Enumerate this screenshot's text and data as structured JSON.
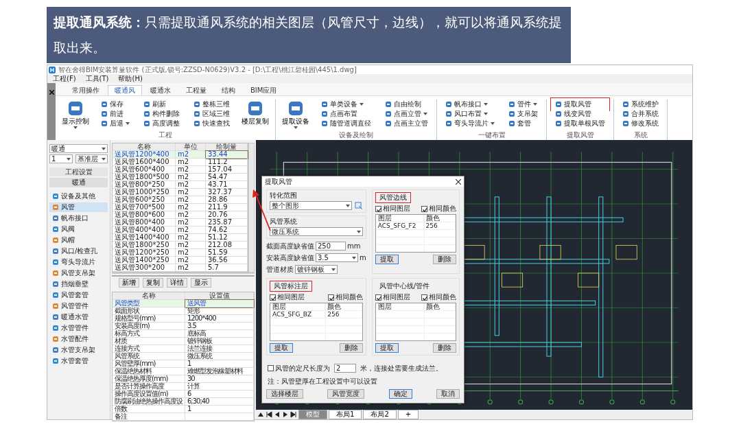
{
  "banner": {
    "text": "**提取通风系统：**只需提取通风系统的相关图层（风管尺寸，边线），就可以将通风系统提取出来。"
  },
  "app": {
    "title": "智在舍得BIM安装算量软件 (正式版,锁号:ZZSD-N0629)V3.2 - [D:\\工程\\桃江碧桂园\\445\\1.dwg]",
    "menu": [
      "工程(F)",
      "工具(T)",
      "帮助(H)"
    ],
    "tabs": [
      {
        "label": "常用操作",
        "selected": false
      },
      {
        "label": "暖通风",
        "selected": true
      },
      {
        "label": "暖通水",
        "selected": false
      },
      {
        "label": "工程量",
        "selected": false
      },
      {
        "label": "结构",
        "selected": false
      },
      {
        "label": "BIM应用",
        "selected": false
      }
    ],
    "ribbon": [
      {
        "label": "工程",
        "items": [
          {
            "label": "显示控制",
            "kind": "large",
            "dropdown": true,
            "highlighted": false
          },
          {
            "label": "保存",
            "kind": "small",
            "dropdown": false,
            "highlighted": false
          },
          {
            "label": "前进",
            "kind": "small",
            "dropdown": false,
            "highlighted": false
          },
          {
            "label": "后退",
            "kind": "small",
            "dropdown": true,
            "highlighted": false
          },
          {
            "label": "刷新",
            "kind": "small",
            "dropdown": false,
            "highlighted": false
          },
          {
            "label": "构件删除",
            "kind": "small",
            "dropdown": false,
            "highlighted": false
          },
          {
            "label": "高度调整",
            "kind": "small",
            "dropdown": false,
            "highlighted": false
          },
          {
            "label": "整栋三维",
            "kind": "small",
            "dropdown": false,
            "highlighted": false
          },
          {
            "label": "区域三维",
            "kind": "small",
            "dropdown": false,
            "highlighted": false
          },
          {
            "label": "快速查找",
            "kind": "small",
            "dropdown": false,
            "highlighted": false
          },
          {
            "label": "楼层复制",
            "kind": "large",
            "dropdown": false,
            "highlighted": false
          }
        ]
      },
      {
        "label": "设备及绘制",
        "items": [
          {
            "label": "提取设备",
            "kind": "large",
            "dropdown": true,
            "highlighted": false
          },
          {
            "label": "单类设备",
            "kind": "small",
            "dropdown": true,
            "highlighted": false
          },
          {
            "label": "点画布置",
            "kind": "small",
            "dropdown": false,
            "highlighted": false
          },
          {
            "label": "随管道调直径",
            "kind": "small",
            "dropdown": false,
            "highlighted": false
          },
          {
            "label": "自由绘制",
            "kind": "small",
            "dropdown": false,
            "highlighted": false
          },
          {
            "label": "点画立管",
            "kind": "small",
            "dropdown": true,
            "highlighted": false
          },
          {
            "label": "点画主立管",
            "kind": "small",
            "dropdown": false,
            "highlighted": false
          }
        ]
      },
      {
        "label": "一键布置",
        "items": [
          {
            "label": "帆布接口",
            "kind": "small",
            "dropdown": true,
            "highlighted": false
          },
          {
            "label": "风口布置",
            "kind": "small",
            "dropdown": true,
            "highlighted": false
          },
          {
            "label": "弯头导流片",
            "kind": "small",
            "dropdown": true,
            "highlighted": false
          },
          {
            "label": "管件",
            "kind": "small",
            "dropdown": true,
            "highlighted": false
          },
          {
            "label": "支吊架",
            "kind": "small",
            "dropdown": false,
            "highlighted": false
          },
          {
            "label": "套管",
            "kind": "small",
            "dropdown": false,
            "highlighted": false
          }
        ]
      },
      {
        "label": "提取风管",
        "items": [
          {
            "label": "提取风管",
            "kind": "small",
            "dropdown": false,
            "highlighted": true
          },
          {
            "label": "线变风管",
            "kind": "small",
            "dropdown": false,
            "highlighted": false
          },
          {
            "label": "提取单根风管",
            "kind": "small",
            "dropdown": false,
            "highlighted": false
          }
        ]
      },
      {
        "label": "系统",
        "items": [
          {
            "label": "系统维护",
            "kind": "small",
            "dropdown": false,
            "highlighted": false
          },
          {
            "label": "合并系统",
            "kind": "small",
            "dropdown": false,
            "highlighted": false
          },
          {
            "label": "修改系统",
            "kind": "small",
            "dropdown": false,
            "highlighted": false
          }
        ]
      }
    ],
    "left_panel": {
      "discipline": "暖通",
      "floor": "1",
      "floor_type": "基准层",
      "settings_button": "工程设置",
      "section": "暖通",
      "items": [
        {
          "label": "设备及其他",
          "selected": false
        },
        {
          "label": "风管",
          "selected": true
        },
        {
          "label": "帆布接口",
          "selected": false
        },
        {
          "label": "风阀",
          "selected": false
        },
        {
          "label": "风帽",
          "selected": false
        },
        {
          "label": "风口/检查孔",
          "selected": false
        },
        {
          "label": "弯头导流片",
          "selected": false
        },
        {
          "label": "风管支吊架",
          "selected": false
        },
        {
          "label": "挡烟垂壁",
          "selected": false
        },
        {
          "label": "风管套管",
          "selected": false
        },
        {
          "label": "风管管件",
          "selected": false
        },
        {
          "label": "暖通水管",
          "selected": false
        },
        {
          "label": "水管管件",
          "selected": false
        },
        {
          "label": "水管配件",
          "selected": false
        },
        {
          "label": "水管支吊架",
          "selected": false
        },
        {
          "label": "水管套管",
          "selected": false
        }
      ]
    },
    "component_table": {
      "columns": [
        "名称",
        "单位",
        "绘制量"
      ],
      "rows": [
        {
          "cells": [
            "送风管1200*400",
            "m2",
            "33.44"
          ],
          "selected": true
        },
        {
          "cells": [
            "送风管1600*400",
            "m2",
            "111.2"
          ],
          "selected": false
        },
        {
          "cells": [
            "送风管600*400",
            "m2",
            "157.04"
          ],
          "selected": false
        },
        {
          "cells": [
            "送风管1800*500",
            "m2",
            "54.47"
          ],
          "selected": false
        },
        {
          "cells": [
            "送风管800*250",
            "m2",
            "43.71"
          ],
          "selected": false
        },
        {
          "cells": [
            "送风管1000*250",
            "m2",
            "327.37"
          ],
          "selected": false
        },
        {
          "cells": [
            "送风管600*250",
            "m2",
            "28.86"
          ],
          "selected": false
        },
        {
          "cells": [
            "送风管700*500",
            "m2",
            "211.9"
          ],
          "selected": false
        },
        {
          "cells": [
            "送风管800*600",
            "m2",
            "20.76"
          ],
          "selected": false
        },
        {
          "cells": [
            "送风管800*400",
            "m2",
            "235.87"
          ],
          "selected": false
        },
        {
          "cells": [
            "送风管400*400",
            "m2",
            "74.62"
          ],
          "selected": false
        },
        {
          "cells": [
            "送风管1400*400",
            "m2",
            "51.12"
          ],
          "selected": false
        },
        {
          "cells": [
            "送风管1800*250",
            "m2",
            "212.08"
          ],
          "selected": false
        },
        {
          "cells": [
            "送风管1200*250",
            "m2",
            "51.59"
          ],
          "selected": false
        },
        {
          "cells": [
            "送风管1400*250",
            "m2",
            "36.56"
          ],
          "selected": false
        },
        {
          "cells": [
            "送风管300*200",
            "m2",
            "5.7"
          ],
          "selected": false
        }
      ]
    },
    "table_buttons": [
      "新增",
      "复制",
      "详情",
      "显示"
    ],
    "property_table": {
      "columns": [
        "名称",
        "设置值"
      ],
      "rows": [
        {
          "cells": [
            "风管类型",
            "送风管"
          ],
          "selected": true
        },
        {
          "cells": [
            "截面形状",
            "矩形"
          ],
          "selected": false
        },
        {
          "cells": [
            "规格型号(mm)",
            "1200*400"
          ],
          "selected": false
        },
        {
          "cells": [
            "安装高度(m)",
            "3.5"
          ],
          "selected": false
        },
        {
          "cells": [
            "标高方式",
            "底标高"
          ],
          "selected": false
        },
        {
          "cells": [
            "材质",
            "镀锌钢板"
          ],
          "selected": false
        },
        {
          "cells": [
            "连接方式",
            "法兰连接"
          ],
          "selected": false
        },
        {
          "cells": [
            "风管系统",
            "微压系统"
          ],
          "selected": false
        },
        {
          "cells": [
            "风管壁厚(mm)",
            "1"
          ],
          "selected": false
        },
        {
          "cells": [
            "保温绝热材料",
            "难燃型发泡橡塑材料"
          ],
          "selected": false
        },
        {
          "cells": [
            "保温绝热厚度(mm)",
            "30"
          ],
          "selected": false
        },
        {
          "cells": [
            "是否计算操作高度",
            "计算"
          ],
          "selected": false
        },
        {
          "cells": [
            "操作高度设置值(m)",
            "6"
          ],
          "selected": false
        },
        {
          "cells": [
            "防腐刷油绝热操作高度设",
            "6;30;40"
          ],
          "selected": false
        },
        {
          "cells": [
            "倍数",
            "1"
          ],
          "selected": false
        },
        {
          "cells": [
            "备注"
          ],
          "selected": false
        }
      ]
    },
    "layout_tabs": [
      {
        "label": "模型",
        "selected": true
      },
      {
        "label": "布局1",
        "selected": false
      },
      {
        "label": "布局2",
        "selected": false
      },
      {
        "label": "+",
        "selected": false
      }
    ],
    "dialog": {
      "title": "提取风管",
      "range": {
        "label": "转化范围",
        "value": "整个图形"
      },
      "system": {
        "label": "风管系统",
        "value": "微压系统"
      },
      "fields": [
        {
          "label": "截面高度缺省值",
          "value": "250",
          "unit": "mm",
          "kind": "text"
        },
        {
          "label": "安装高度缺省值",
          "value": "3.5",
          "unit": "m",
          "kind": "combo"
        },
        {
          "label": "管道材质",
          "value": "镀锌钢板",
          "kind": "combo"
        }
      ],
      "groups": [
        {
          "title": "风管边线",
          "highlighted": true,
          "options": [
            {
              "label": "相同图层",
              "checked": true
            },
            {
              "label": "相同颜色",
              "checked": true
            }
          ],
          "columns": [
            "图层",
            "颜色"
          ],
          "rows": [
            [
              "ACS_SFG_F2",
              "256"
            ]
          ],
          "buttons": [
            {
              "label": "提取",
              "default": true
            },
            {
              "label": "删除",
              "default": false
            }
          ]
        },
        {
          "title": "风管标注层",
          "highlighted": true,
          "options": [
            {
              "label": "相同图层",
              "checked": true
            },
            {
              "label": "相同颜色",
              "checked": true
            }
          ],
          "columns": [
            "图层",
            "颜色"
          ],
          "rows": [
            [
              "ACS_SFG_BZ",
              "256"
            ]
          ],
          "buttons": [
            {
              "label": "提取",
              "default": true
            },
            {
              "label": "删除",
              "default": false
            }
          ]
        },
        {
          "title": "风管中心线/管件",
          "highlighted": false,
          "options": [
            {
              "label": "相同图层",
              "checked": true
            },
            {
              "label": "相同颜色",
              "checked": true
            }
          ],
          "columns": [
            "图层",
            "颜色"
          ],
          "buttons": [
            {
              "label": "提取",
              "default": true
            },
            {
              "label": "删除",
              "default": false
            }
          ]
        }
      ],
      "fixed_length": {
        "checked": false,
        "label": "风管的定尺长度为",
        "value": "2",
        "suffix": "米，连接处需要生成法兰。"
      },
      "note": "注：风管壁厚在工程设置中可以设置",
      "buttons": [
        {
          "label": "选择楼层",
          "default": false
        },
        {
          "label": "风管宽度",
          "default": false
        },
        {
          "label": "确定",
          "default": true
        },
        {
          "label": "取消",
          "default": false
        }
      ]
    }
  }
}
